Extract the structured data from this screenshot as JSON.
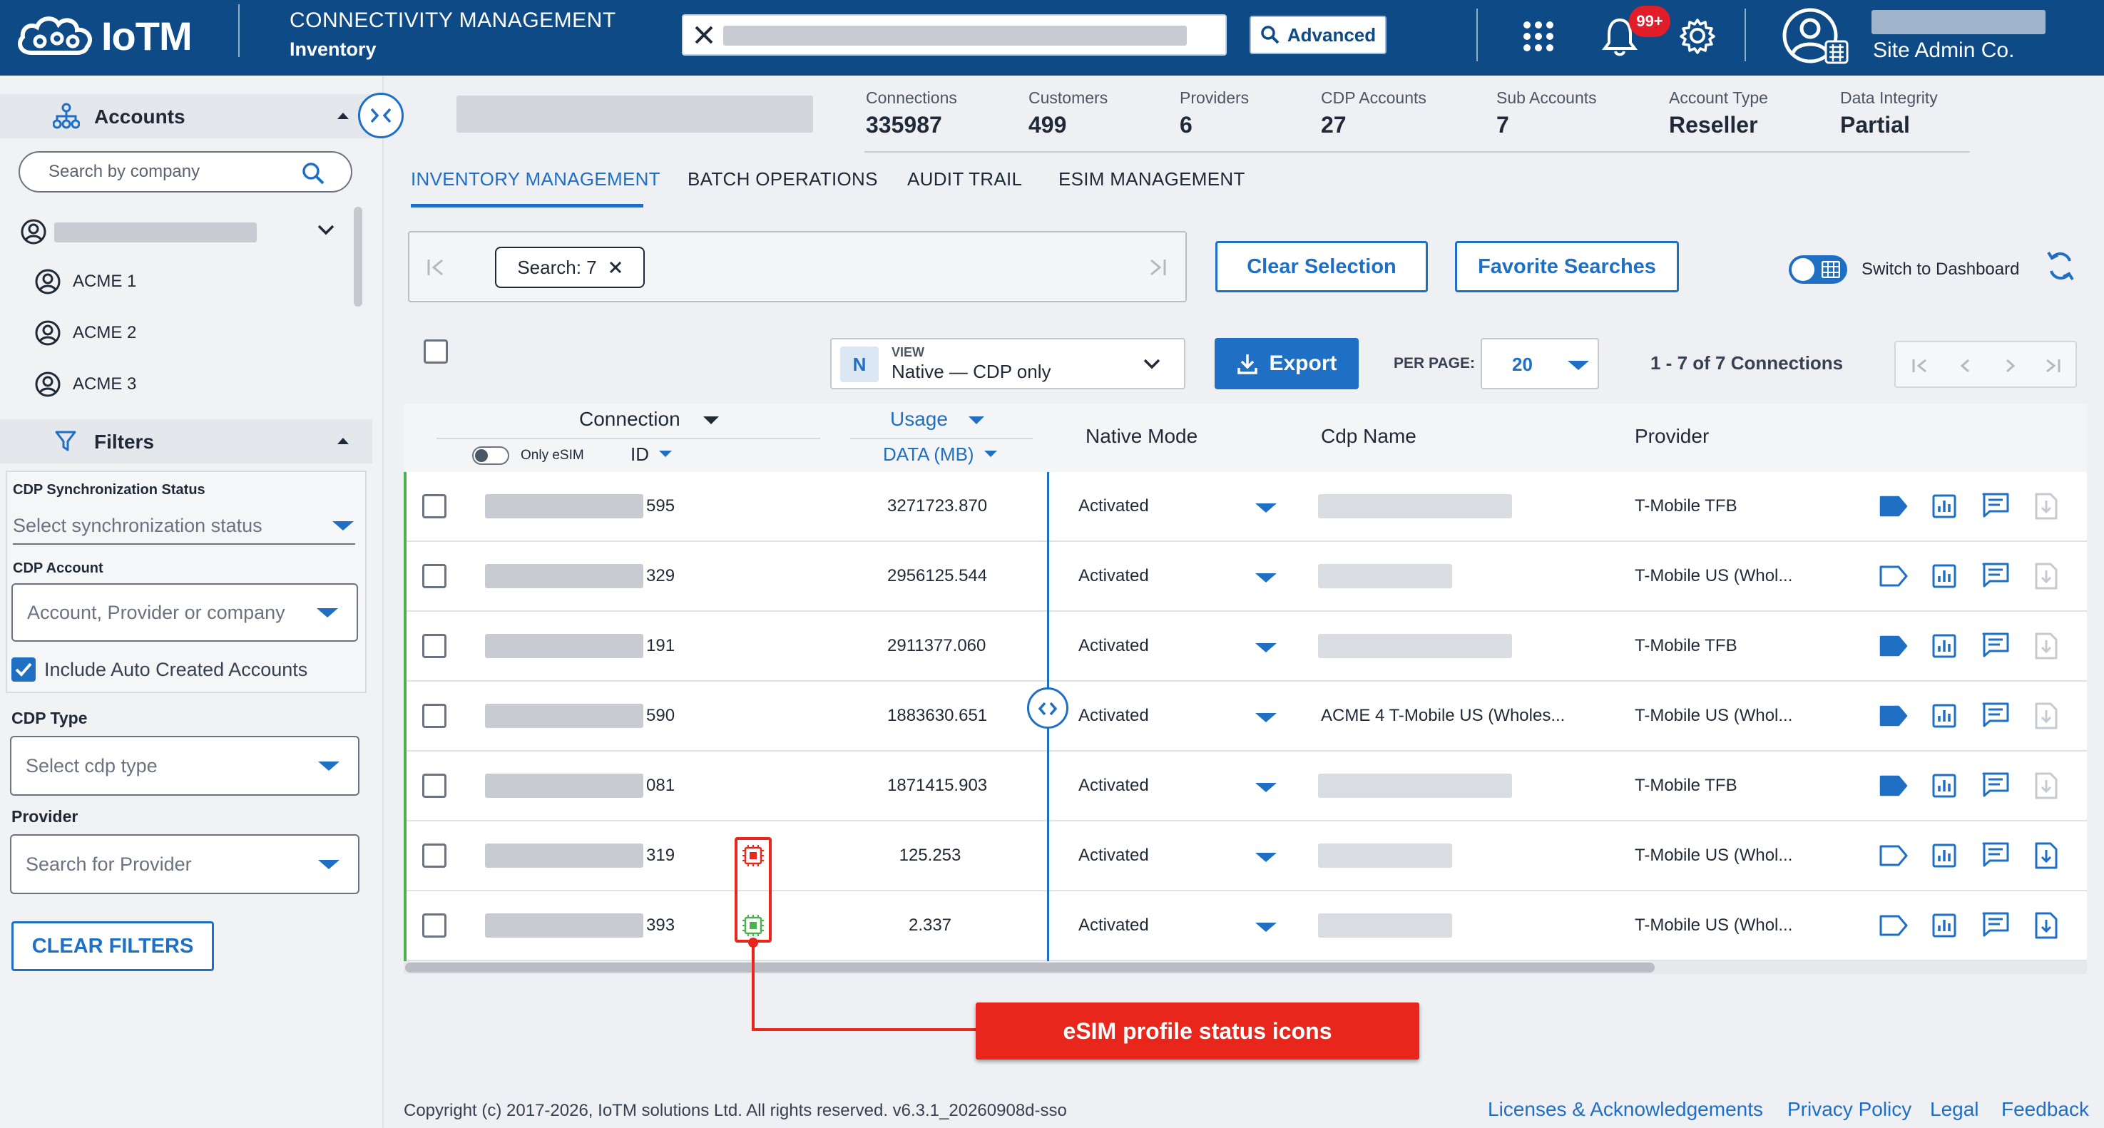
{
  "header": {
    "app_name": "IoTM",
    "title": "CONNECTIVITY MANAGEMENT",
    "subtitle": "Inventory",
    "advanced_label": "Advanced",
    "notification_count": "99+",
    "user_role": "Site Admin Co."
  },
  "sidebar": {
    "accounts_title": "Accounts",
    "search_placeholder": "Search by company",
    "accounts": [
      "ACME 1",
      "ACME 2",
      "ACME 3"
    ],
    "filters_title": "Filters",
    "cdp_sync_label": "CDP Synchronization Status",
    "cdp_sync_placeholder": "Select synchronization status",
    "cdp_account_label": "CDP Account",
    "cdp_account_placeholder": "Account, Provider or company",
    "include_auto_label": "Include Auto Created Accounts",
    "cdp_type_label": "CDP Type",
    "cdp_type_placeholder": "Select cdp type",
    "provider_label": "Provider",
    "provider_placeholder": "Search for Provider",
    "clear_filters_label": "CLEAR FILTERS"
  },
  "stats": [
    {
      "label": "Connections",
      "value": "335987"
    },
    {
      "label": "Customers",
      "value": "499"
    },
    {
      "label": "Providers",
      "value": "6"
    },
    {
      "label": "CDP Accounts",
      "value": "27"
    },
    {
      "label": "Sub Accounts",
      "value": "7"
    },
    {
      "label": "Account Type",
      "value": "Reseller"
    },
    {
      "label": "Data Integrity",
      "value": "Partial"
    }
  ],
  "tabs": [
    "INVENTORY MANAGEMENT",
    "BATCH OPERATIONS",
    "AUDIT TRAIL",
    "ESIM MANAGEMENT"
  ],
  "toolbar": {
    "search_chip": "Search: 7",
    "clear_selection": "Clear Selection",
    "favorite_searches": "Favorite Searches",
    "switch_dashboard": "Switch to Dashboard",
    "view_badge": "N",
    "view_label": "VIEW",
    "view_value": "Native — CDP only",
    "export_label": "Export",
    "per_page_label": "PER PAGE:",
    "per_page_value": "20",
    "pagination": "1 - 7 of 7 Connections"
  },
  "table": {
    "headers": {
      "connection": "Connection",
      "only_esim": "Only eSIM",
      "id": "ID",
      "usage": "Usage",
      "data_mb": "DATA (MB)",
      "native_mode": "Native Mode",
      "cdp_name": "Cdp Name",
      "provider": "Provider"
    },
    "rows": [
      {
        "id_suffix": "595",
        "usage": "3271723.870",
        "mode": "Activated",
        "cdp_name": "",
        "provider": "T-Mobile TFB",
        "tag_filled": true
      },
      {
        "id_suffix": "329",
        "usage": "2956125.544",
        "mode": "Activated",
        "cdp_name": "",
        "provider": "T-Mobile US (Whol...",
        "tag_filled": false
      },
      {
        "id_suffix": "191",
        "usage": "2911377.060",
        "mode": "Activated",
        "cdp_name": "",
        "provider": "T-Mobile TFB",
        "tag_filled": true
      },
      {
        "id_suffix": "590",
        "usage": "1883630.651",
        "mode": "Activated",
        "cdp_name": "ACME 4 T-Mobile US (Wholes...",
        "provider": "T-Mobile US (Whol...",
        "tag_filled": true
      },
      {
        "id_suffix": "081",
        "usage": "1871415.903",
        "mode": "Activated",
        "cdp_name": "",
        "provider": "T-Mobile TFB",
        "tag_filled": true
      },
      {
        "id_suffix": "319",
        "usage": "125.253",
        "mode": "Activated",
        "cdp_name": "",
        "provider": "T-Mobile US (Whol...",
        "tag_filled": false
      },
      {
        "id_suffix": "393",
        "usage": "2.337",
        "mode": "Activated",
        "cdp_name": "",
        "provider": "T-Mobile US (Whol...",
        "tag_filled": false
      }
    ]
  },
  "callout": "eSIM profile status icons",
  "footer": {
    "copyright": "Copyright (c) 2017-2026, IoTM solutions Ltd. All rights reserved. v6.3.1_20260908d-sso",
    "links": [
      "Licenses & Acknowledgements",
      "Privacy Policy",
      "Legal",
      "Feedback"
    ]
  },
  "colors": {
    "header_bg": "#0d4a86",
    "accent": "#1f6fc4",
    "callout": "#e8261b",
    "row_active": "#4caf50"
  }
}
